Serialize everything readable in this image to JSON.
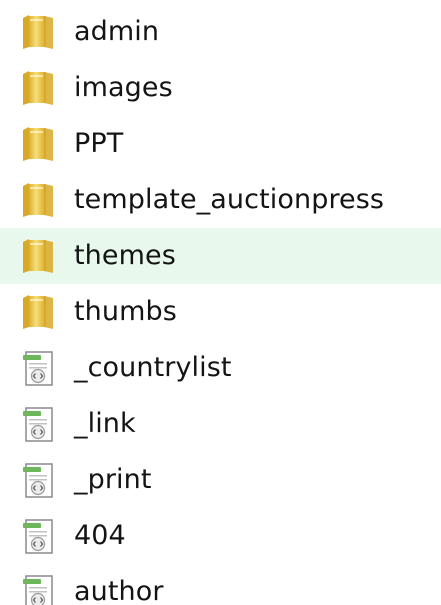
{
  "explorer": {
    "hovered_index": 4,
    "items": [
      {
        "name": "admin",
        "type": "folder",
        "icon": "folder-icon"
      },
      {
        "name": "images",
        "type": "folder",
        "icon": "folder-icon"
      },
      {
        "name": "PPT",
        "type": "folder",
        "icon": "folder-icon"
      },
      {
        "name": "template_auctionpress",
        "type": "folder",
        "icon": "folder-icon"
      },
      {
        "name": "themes",
        "type": "folder",
        "icon": "folder-icon"
      },
      {
        "name": "thumbs",
        "type": "folder",
        "icon": "folder-icon"
      },
      {
        "name": "_countrylist",
        "type": "php-file",
        "icon": "code-file-icon"
      },
      {
        "name": "_link",
        "type": "php-file",
        "icon": "code-file-icon"
      },
      {
        "name": "_print",
        "type": "php-file",
        "icon": "code-file-icon"
      },
      {
        "name": "404",
        "type": "php-file",
        "icon": "code-file-icon"
      },
      {
        "name": "author",
        "type": "php-file",
        "icon": "code-file-icon"
      }
    ]
  },
  "colors": {
    "hover_bg": "#e8f8ec",
    "text": "#141414",
    "folder_light": "#f6df7c",
    "folder_dark": "#d9a824",
    "file_green": "#6db65b"
  }
}
